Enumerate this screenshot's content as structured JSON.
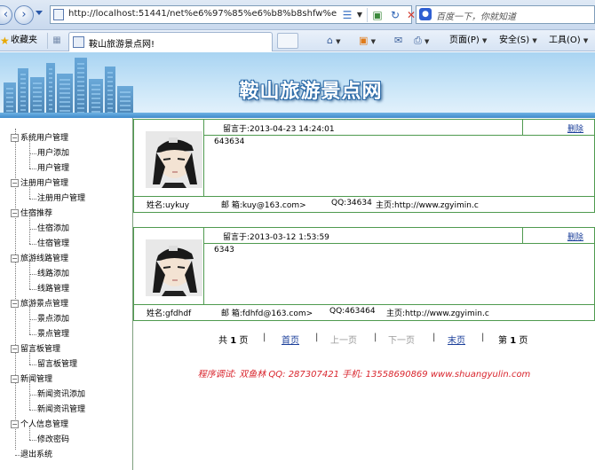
{
  "browser": {
    "url": "http://localhost:51441/net%e6%97%85%e6%b8%b8shfw%e",
    "search_placeholder": "百度一下，你就知道",
    "favorites_label": "收藏夹",
    "tab_title": "鞍山旅游景点网!",
    "menu_page": "页面(P)",
    "menu_safety": "安全(S)",
    "menu_tools": "工具(O)",
    "icon_back": "arrow-left-icon",
    "icon_forward": "arrow-right-icon"
  },
  "site": {
    "title": "鞍山旅游景点网"
  },
  "sidebar": {
    "groups": [
      {
        "label": "系统用户管理",
        "items": [
          "用户添加",
          "用户管理"
        ]
      },
      {
        "label": "注册用户管理",
        "items": [
          "注册用户管理"
        ]
      },
      {
        "label": "住宿推荐",
        "items": [
          "住宿添加",
          "住宿管理"
        ]
      },
      {
        "label": "旅游线路管理",
        "items": [
          "线路添加",
          "线路管理"
        ]
      },
      {
        "label": "旅游景点管理",
        "items": [
          "景点添加",
          "景点管理"
        ]
      },
      {
        "label": "留言板管理",
        "items": [
          "留言板管理"
        ]
      },
      {
        "label": "新闻管理",
        "items": [
          "新闻资讯添加",
          "新闻资讯管理"
        ]
      },
      {
        "label": "个人信息管理",
        "items": [
          "修改密码"
        ]
      }
    ],
    "logout": "退出系统"
  },
  "messages": [
    {
      "time": "留言于:2013-04-23 14:24:01",
      "delete": "删除",
      "content": "643634",
      "name": "姓名:uykuy",
      "email": "邮 箱:kuy@163.com>",
      "qq": "QQ:34634",
      "homepage": "主页:http://www.zgyimin.c"
    },
    {
      "time": "留言于:2013-03-12 1:53:59",
      "delete": "删除",
      "content": "6343",
      "name": "姓名:gfdhdf",
      "email": "邮 箱:fdhfd@163.com>",
      "qq": "QQ:463464",
      "homepage": "主页:http://www.zgyimin.c"
    }
  ],
  "pager": {
    "total_pre": "共",
    "total_num": "1",
    "total_post": "页",
    "first": "首页",
    "prev": "上一页",
    "next": "下一页",
    "last": "末页",
    "cur_pre": "第",
    "cur_num": "1",
    "cur_post": "页"
  },
  "footer": {
    "credit": "程序调试: 双鱼林   QQ: 287307421   手机: 13558690869   www.shuangyulin.com"
  },
  "colors": {
    "border_green": "#4f9a4f",
    "link_blue": "#1b3f9a",
    "credit_red": "#d9262e"
  }
}
